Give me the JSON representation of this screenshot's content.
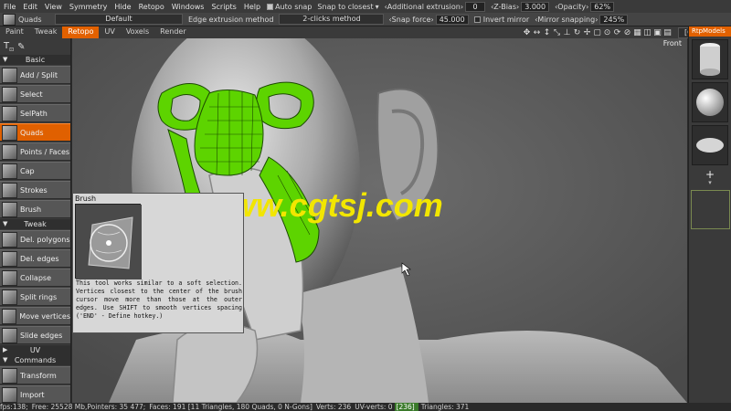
{
  "menubar": {
    "items": [
      "File",
      "Edit",
      "View",
      "Symmetry",
      "Hide",
      "Retopo",
      "Windows",
      "Scripts",
      "Help"
    ],
    "auto_snap": "Auto snap",
    "snap_to_closest": "Snap to closest",
    "additional_extrusion_label": "‹Additional extrusion›",
    "additional_extrusion_value": "0",
    "z_bias_label": "‹Z-Bias›",
    "z_bias_value": "3.000",
    "opacity_label": "‹Opacity›",
    "opacity_value": "62%"
  },
  "toolrow": {
    "mode": "Quads",
    "mode_value": "Default",
    "edge_extrusion_label": "Edge extrusion method",
    "edge_extrusion_value": "2-clicks method",
    "snap_force_label": "‹Snap force›",
    "snap_force_value": "45.000",
    "invert_mirror": "Invert mirror",
    "mirror_snapping_label": "‹Mirror snapping›",
    "mirror_snapping_value": "245%"
  },
  "tabs": [
    "Paint",
    "Tweak",
    "Retopo",
    "UV",
    "Voxels",
    "Render"
  ],
  "active_tab": "Retopo",
  "camera_value": "[Camera]",
  "viewport": {
    "view_label": "Front",
    "watermark": "www.cgtsj.com"
  },
  "left_panel": {
    "sections": {
      "basic": "Basic",
      "tweak": "Tweak",
      "uv": "UV",
      "commands": "Commands"
    },
    "basic_tools": [
      "Add / Split",
      "Select",
      "SelPath",
      "Quads",
      "Points / Faces",
      "Cap",
      "Strokes",
      "Brush"
    ],
    "active_tool": "Quads",
    "tweak_tools": [
      "Del. polygons",
      "Del. edges",
      "Collapse",
      "Split rings",
      "Move vertices",
      "Slide edges"
    ],
    "command_tools": [
      "Transform",
      "Import"
    ]
  },
  "tooltip": {
    "title": "Brush",
    "text": "This tool works similar to a soft selection. Vertices closest to the center of the brush cursor move more than those at the outer edges. Use SHIFT to smooth vertices spacing ('END' - Define hotkey.)"
  },
  "right_panel": {
    "title": "RtpModels",
    "add_label": "+"
  },
  "status": {
    "fps": "fps:138;",
    "free": "Free: 25528 Mb,Pointers: 35 477;",
    "faces": "Faces: 191 [11 Triangles, 180 Quads, 0 N-Gons]",
    "verts": "Verts: 236",
    "uv_verts_label": "UV-verts: 0",
    "uv_verts_highlight": "[236]",
    "triangles": "Triangles: 371"
  },
  "colors": {
    "accent": "#e26100",
    "mesh_green": "#5dd400",
    "watermark_yellow": "#f2e600"
  }
}
